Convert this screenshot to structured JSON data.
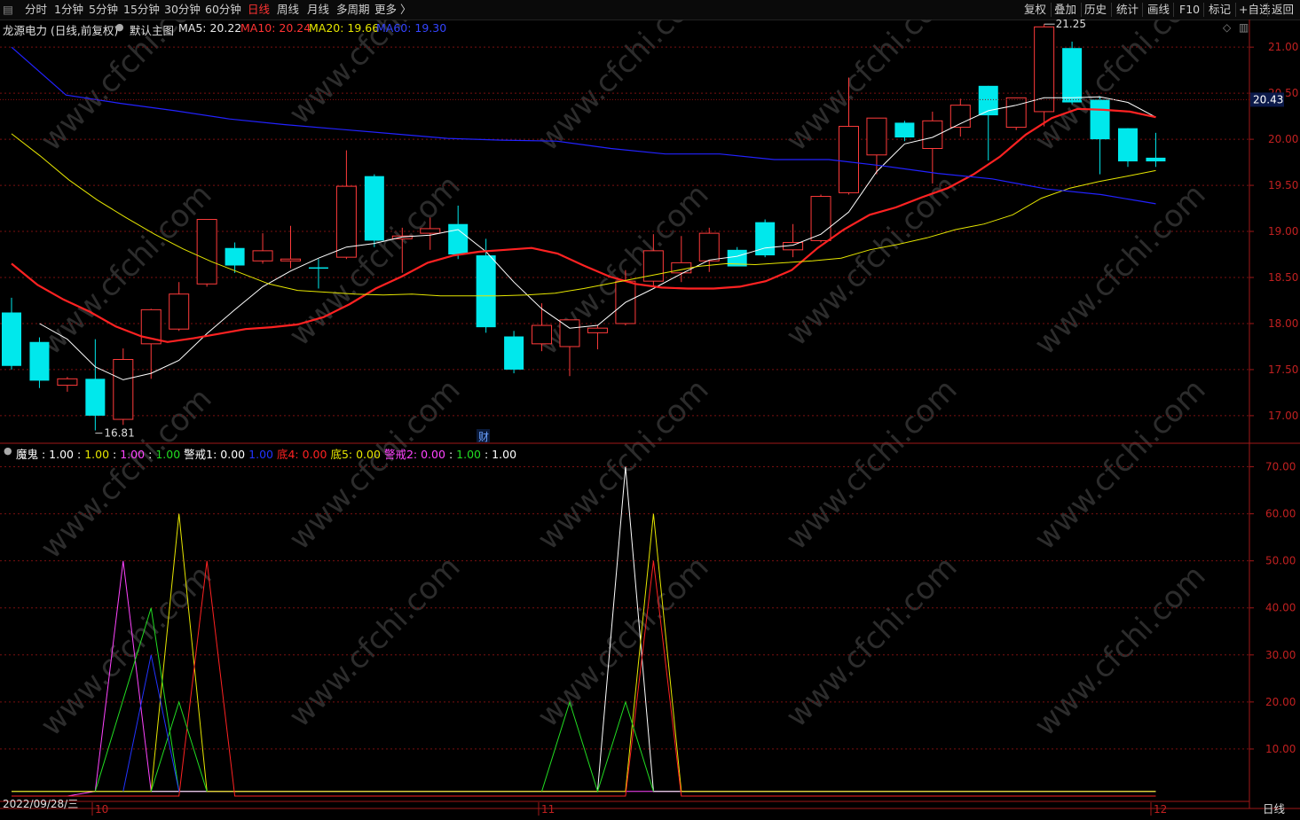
{
  "toolbar": {
    "left_buttons": [
      "分时",
      "1分钟",
      "5分钟",
      "15分钟",
      "30分钟",
      "60分钟",
      "日线",
      "周线",
      "月线",
      "多周期",
      "更多 〉"
    ],
    "active": "日线",
    "right_buttons": [
      "复权",
      "叠加",
      "历史",
      "统计",
      "画线",
      "F10",
      "标记",
      "+自选",
      "返回"
    ]
  },
  "header": {
    "stock": "龙源电力 (日线,前复权)",
    "template": "默认主图",
    "ma5_label": "MA5: 20.22",
    "ma10_label": "MA10: 20.24",
    "ma20_label": "MA20: 19.66",
    "ma60_label": "MA60: 19.30"
  },
  "colors": {
    "up": "#ff3b3b",
    "down": "#00e8ec",
    "ma5": "#ffffff",
    "ma10": "#ff2222",
    "ma20": "#e6e600",
    "ma60": "#2222ff",
    "grid": "#7a1010",
    "axis_border": "#a01818"
  },
  "indicator_header": [
    {
      "text": "魔鬼 : 1.00 :",
      "color": "#ffffff"
    },
    {
      "text": "1.00",
      "color": "#e6e600"
    },
    {
      "text": ":",
      "color": "#ffffff"
    },
    {
      "text": "1.00",
      "color": "#ff44ff"
    },
    {
      "text": ":",
      "color": "#ffffff"
    },
    {
      "text": "1.00",
      "color": "#22dd22"
    },
    {
      "text": "警戒1: 0.00",
      "color": "#ffffff"
    },
    {
      "text": "1.00",
      "color": "#2233ff"
    },
    {
      "text": "底4: 0.00",
      "color": "#ff2222"
    },
    {
      "text": "底5: 0.00",
      "color": "#e6e600"
    },
    {
      "text": "警戒2: 0.00",
      "color": "#ff44ff"
    },
    {
      "text": ":",
      "color": "#ffffff"
    },
    {
      "text": "1.00",
      "color": "#22dd22"
    },
    {
      "text": ": 1.00",
      "color": "#ffffff"
    }
  ],
  "annotations": {
    "high_label": "21.25",
    "low_label": "16.81",
    "cai_marker": "财",
    "price_tag": "20.43",
    "date_label": "2022/09/28/三",
    "period_label": "日线"
  },
  "chart_data": [
    {
      "type": "candlestick",
      "ylim": [
        16.72,
        21.3
      ],
      "y_ticks": [
        17.0,
        17.5,
        18.0,
        18.5,
        19.0,
        19.5,
        20.0,
        20.5,
        21.0
      ],
      "x_axis_labels": [
        "10",
        "11",
        "12"
      ],
      "candles": [
        {
          "o": 18.12,
          "h": 18.28,
          "l": 17.5,
          "c": 17.54
        },
        {
          "o": 17.8,
          "h": 17.85,
          "l": 17.3,
          "c": 17.38
        },
        {
          "o": 17.33,
          "h": 17.42,
          "l": 17.26,
          "c": 17.4
        },
        {
          "o": 17.4,
          "h": 17.83,
          "l": 16.84,
          "c": 17.0
        },
        {
          "o": 16.96,
          "h": 17.73,
          "l": 16.9,
          "c": 17.61
        },
        {
          "o": 17.78,
          "h": 18.16,
          "l": 17.4,
          "c": 18.15
        },
        {
          "o": 17.94,
          "h": 18.45,
          "l": 17.92,
          "c": 18.32
        },
        {
          "o": 18.43,
          "h": 19.1,
          "l": 18.4,
          "c": 19.13
        },
        {
          "o": 18.82,
          "h": 18.88,
          "l": 18.55,
          "c": 18.63
        },
        {
          "o": 18.68,
          "h": 18.98,
          "l": 18.65,
          "c": 18.79
        },
        {
          "o": 18.68,
          "h": 19.06,
          "l": 18.6,
          "c": 18.7
        },
        {
          "o": 18.61,
          "h": 18.7,
          "l": 18.38,
          "c": 18.6
        },
        {
          "o": 18.72,
          "h": 19.88,
          "l": 18.7,
          "c": 19.49
        },
        {
          "o": 19.6,
          "h": 19.62,
          "l": 18.83,
          "c": 18.9
        },
        {
          "o": 18.92,
          "h": 19.04,
          "l": 18.55,
          "c": 18.95
        },
        {
          "o": 18.98,
          "h": 19.15,
          "l": 18.8,
          "c": 19.03
        },
        {
          "o": 19.08,
          "h": 19.28,
          "l": 18.7,
          "c": 18.75
        },
        {
          "o": 18.74,
          "h": 18.92,
          "l": 17.9,
          "c": 17.96
        },
        {
          "o": 17.86,
          "h": 17.92,
          "l": 17.46,
          "c": 17.5
        },
        {
          "o": 17.78,
          "h": 18.22,
          "l": 17.7,
          "c": 17.98
        },
        {
          "o": 17.75,
          "h": 18.0,
          "l": 17.43,
          "c": 18.04
        },
        {
          "o": 17.9,
          "h": 17.98,
          "l": 17.72,
          "c": 17.95
        },
        {
          "o": 18.0,
          "h": 18.58,
          "l": 17.98,
          "c": 18.46
        },
        {
          "o": 18.46,
          "h": 18.97,
          "l": 18.4,
          "c": 18.79
        },
        {
          "o": 18.55,
          "h": 18.95,
          "l": 18.45,
          "c": 18.66
        },
        {
          "o": 18.68,
          "h": 19.04,
          "l": 18.56,
          "c": 18.98
        },
        {
          "o": 18.8,
          "h": 18.83,
          "l": 18.63,
          "c": 18.62
        },
        {
          "o": 19.1,
          "h": 19.13,
          "l": 18.72,
          "c": 18.74
        },
        {
          "o": 18.8,
          "h": 19.08,
          "l": 18.72,
          "c": 18.88
        },
        {
          "o": 18.9,
          "h": 19.4,
          "l": 18.88,
          "c": 19.38
        },
        {
          "o": 19.42,
          "h": 20.67,
          "l": 19.4,
          "c": 20.14
        },
        {
          "o": 19.83,
          "h": 20.23,
          "l": 19.62,
          "c": 20.23
        },
        {
          "o": 20.18,
          "h": 20.2,
          "l": 19.98,
          "c": 20.02
        },
        {
          "o": 19.9,
          "h": 20.3,
          "l": 19.52,
          "c": 20.2
        },
        {
          "o": 20.13,
          "h": 20.44,
          "l": 20.03,
          "c": 20.37
        },
        {
          "o": 20.58,
          "h": 20.58,
          "l": 19.77,
          "c": 20.26
        },
        {
          "o": 20.13,
          "h": 20.45,
          "l": 20.1,
          "c": 20.45
        },
        {
          "o": 20.3,
          "h": 21.25,
          "l": 20.14,
          "c": 21.22
        },
        {
          "o": 20.99,
          "h": 21.06,
          "l": 20.38,
          "c": 20.4
        },
        {
          "o": 20.43,
          "h": 20.46,
          "l": 19.62,
          "c": 20.0
        },
        {
          "o": 20.12,
          "h": 20.12,
          "l": 19.7,
          "c": 19.76
        },
        {
          "o": 19.8,
          "h": 20.07,
          "l": 19.7,
          "c": 19.76
        }
      ],
      "series": [
        {
          "name": "MA5",
          "values": [
            null,
            18.0,
            17.83,
            17.53,
            17.39,
            17.46,
            17.6,
            17.89,
            18.15,
            18.4,
            18.57,
            18.71,
            18.83,
            18.87,
            18.94,
            18.96,
            19.02,
            18.78,
            18.45,
            18.16,
            17.95,
            17.98,
            18.23,
            18.38,
            18.54,
            18.69,
            18.73,
            18.82,
            18.85,
            18.97,
            19.21,
            19.65,
            19.95,
            20.02,
            20.17,
            20.31,
            20.37,
            20.45,
            20.45,
            20.46,
            20.4,
            20.24
          ]
        },
        {
          "name": "MA10",
          "values": [
            18.65,
            18.42,
            18.26,
            18.13,
            17.97,
            17.86,
            17.8,
            17.84,
            17.89,
            17.94,
            17.96,
            17.99,
            18.07,
            18.21,
            18.38,
            18.51,
            18.66,
            18.74,
            18.78,
            18.8,
            18.82,
            18.76,
            18.63,
            18.51,
            18.43,
            18.39,
            18.38,
            18.38,
            18.4,
            18.46,
            18.58,
            18.82,
            19.02,
            19.18,
            19.26,
            19.37,
            19.47,
            19.62,
            19.81,
            20.05,
            20.23,
            20.33,
            20.32,
            20.3,
            20.24
          ]
        },
        {
          "name": "MA20",
          "values": [
            20.06,
            19.82,
            19.56,
            19.34,
            19.15,
            18.97,
            18.81,
            18.67,
            18.55,
            18.43,
            18.36,
            18.34,
            18.32,
            18.31,
            18.32,
            18.3,
            18.3,
            18.3,
            18.31,
            18.33,
            18.38,
            18.44,
            18.5,
            18.56,
            18.62,
            18.65,
            18.64,
            18.66,
            18.68,
            18.71,
            18.8,
            18.86,
            18.93,
            19.02,
            19.08,
            19.18,
            19.36,
            19.47,
            19.54,
            19.6,
            19.66
          ]
        },
        {
          "name": "MA60",
          "values": [
            21.0,
            20.48,
            20.39,
            20.31,
            20.22,
            20.16,
            20.11,
            20.06,
            20.01,
            19.99,
            19.98,
            19.9,
            19.84,
            19.84,
            19.78,
            19.78,
            19.71,
            19.63,
            19.57,
            19.46,
            19.4,
            19.3
          ]
        }
      ]
    },
    {
      "type": "line",
      "ylim": [
        0,
        75
      ],
      "y_ticks": [
        10.0,
        20.0,
        30.0,
        40.0,
        50.0,
        60.0,
        70.0
      ],
      "series": [
        {
          "name": "警戒2",
          "values": [
            0,
            0,
            0,
            1,
            50,
            1,
            1,
            1,
            1,
            1,
            1,
            1,
            1,
            1,
            1,
            1,
            1,
            1,
            1,
            1,
            1,
            1,
            1,
            1,
            1,
            1,
            1,
            1,
            1,
            1,
            1,
            1,
            1,
            1,
            1,
            1,
            1,
            1,
            1,
            1,
            1,
            1
          ]
        },
        {
          "name": "魔鬼",
          "values": [
            1,
            1,
            1,
            1,
            1,
            1,
            1,
            1,
            1,
            1,
            1,
            1,
            1,
            1,
            1,
            1,
            1,
            1,
            1,
            1,
            1,
            1,
            70,
            1,
            1,
            1,
            1,
            1,
            1,
            1,
            1,
            1,
            1,
            1,
            1,
            1,
            1,
            1,
            1,
            1,
            1,
            1
          ]
        },
        {
          "name": "底5",
          "values": [
            1,
            1,
            1,
            1,
            1,
            1,
            60,
            1,
            1,
            1,
            1,
            1,
            1,
            1,
            1,
            1,
            1,
            1,
            1,
            1,
            1,
            1,
            1,
            60,
            1,
            1,
            1,
            1,
            1,
            1,
            1,
            1,
            1,
            1,
            1,
            1,
            1,
            1,
            1,
            1,
            1,
            1
          ]
        },
        {
          "name": "底4",
          "values": [
            0,
            0,
            0,
            0,
            0,
            0,
            0,
            50,
            0,
            0,
            0,
            0,
            0,
            0,
            0,
            0,
            0,
            0,
            0,
            0,
            0,
            0,
            0,
            50,
            0,
            0,
            0,
            0,
            0,
            0,
            0,
            0,
            0,
            0,
            0,
            0,
            0,
            0,
            0,
            0,
            0,
            0
          ]
        }
      ]
    }
  ]
}
